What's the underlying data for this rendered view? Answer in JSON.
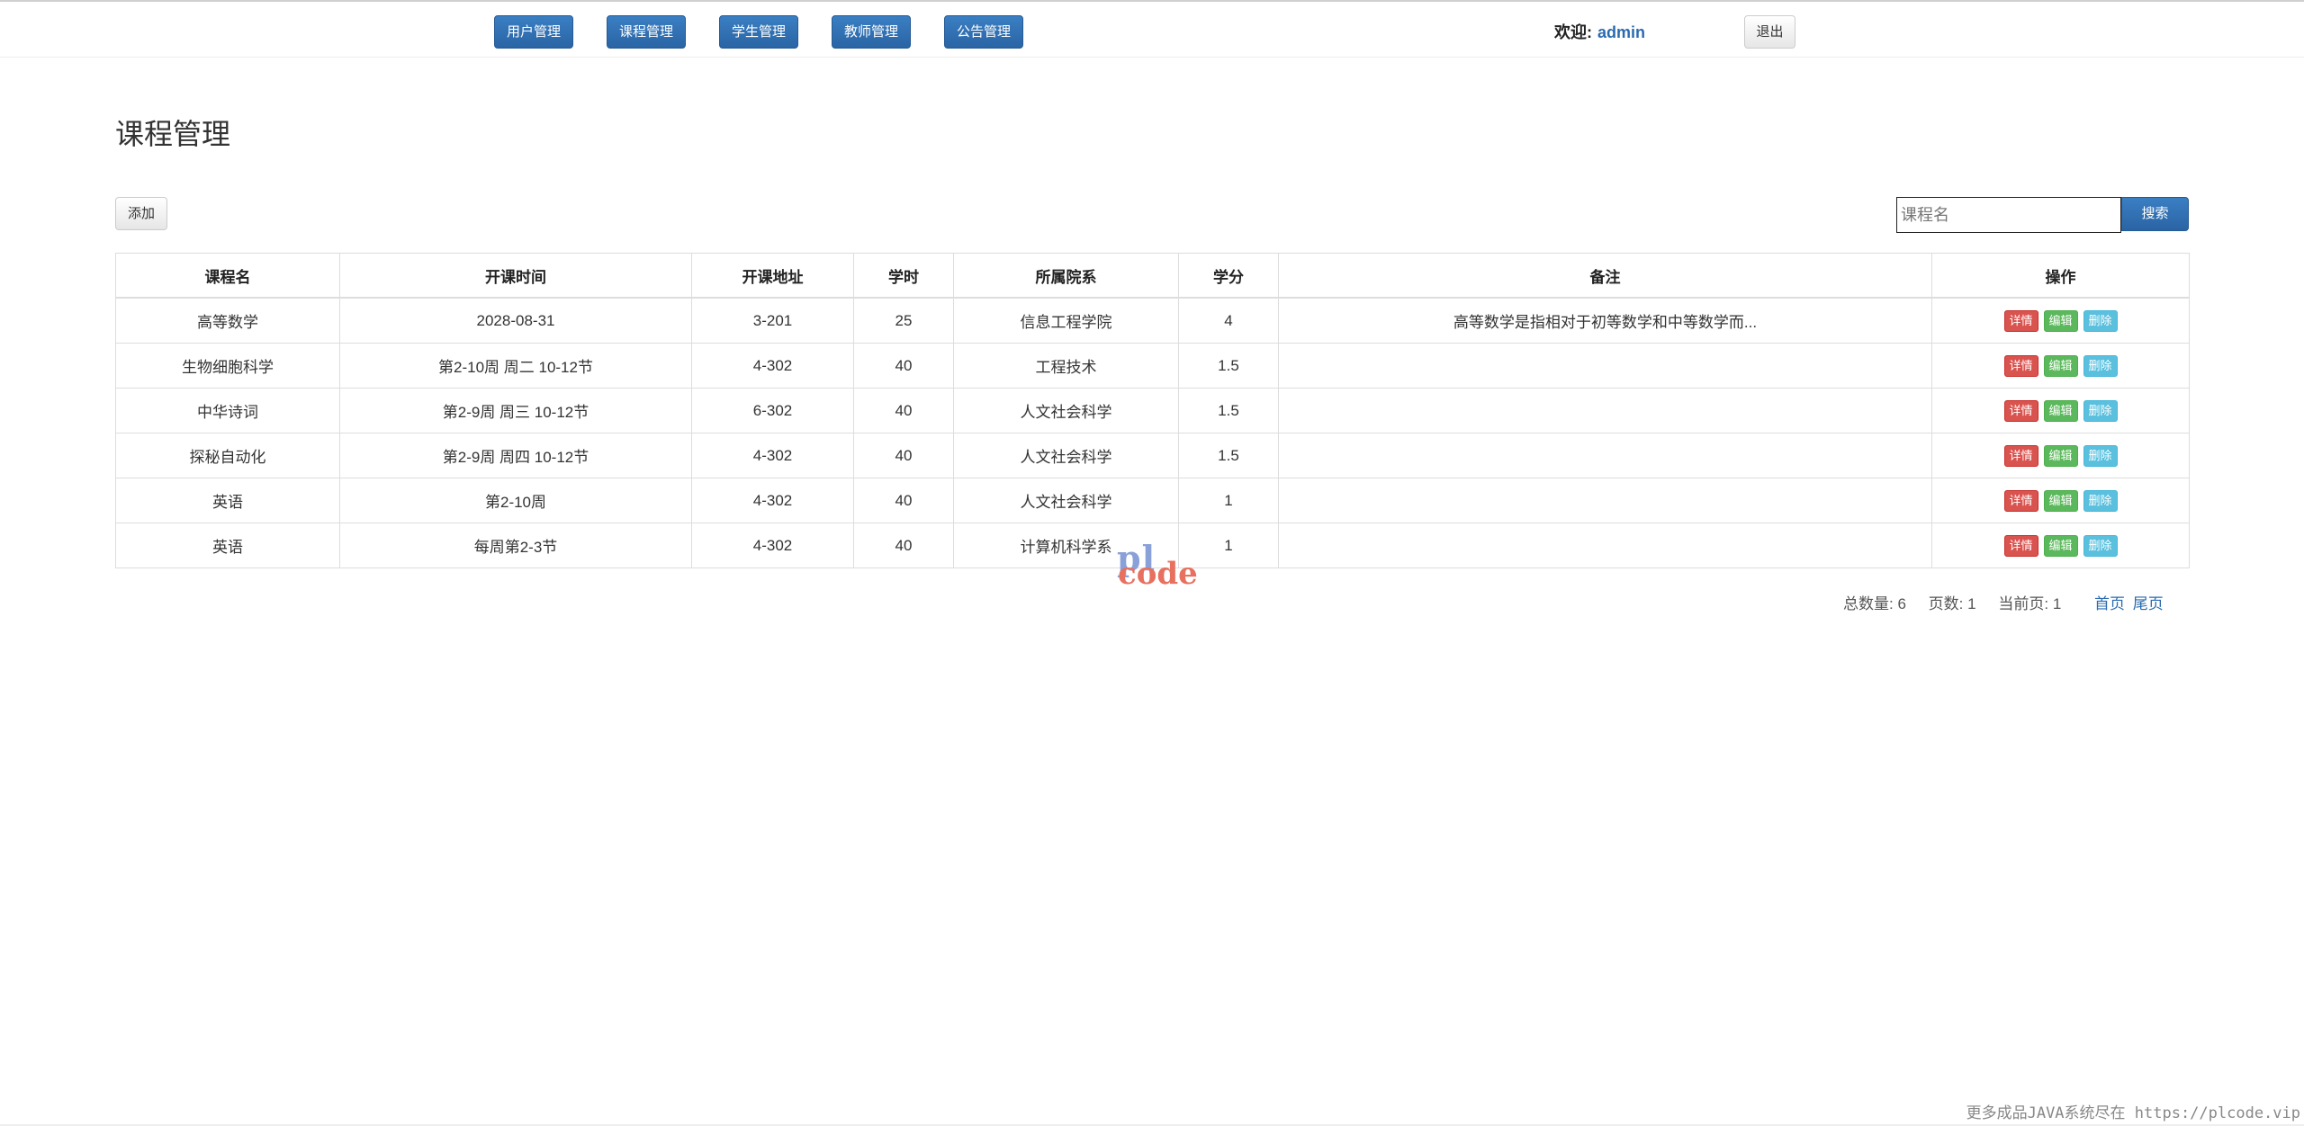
{
  "nav": {
    "items": [
      {
        "label": "用户管理"
      },
      {
        "label": "课程管理"
      },
      {
        "label": "学生管理"
      },
      {
        "label": "教师管理"
      },
      {
        "label": "公告管理"
      }
    ],
    "welcome_label": "欢迎:",
    "username": "admin",
    "logout_label": "退出"
  },
  "page": {
    "title": "课程管理",
    "add_label": "添加"
  },
  "search": {
    "placeholder": "课程名",
    "value": "",
    "button_label": "搜索"
  },
  "table": {
    "headers": [
      "课程名",
      "开课时间",
      "开课地址",
      "学时",
      "所属院系",
      "学分",
      "备注",
      "操作"
    ],
    "rows": [
      {
        "name": "高等数学",
        "time": "2028-08-31",
        "address": "3-201",
        "hours": "25",
        "department": "信息工程学院",
        "credit": "4",
        "remark": "高等数学是指相对于初等数学和中等数学而..."
      },
      {
        "name": "生物细胞科学",
        "time": "第2-10周 周二 10-12节",
        "address": "4-302",
        "hours": "40",
        "department": "工程技术",
        "credit": "1.5",
        "remark": ""
      },
      {
        "name": "中华诗词",
        "time": "第2-9周 周三 10-12节",
        "address": "6-302",
        "hours": "40",
        "department": "人文社会科学",
        "credit": "1.5",
        "remark": ""
      },
      {
        "name": "探秘自动化",
        "time": "第2-9周 周四 10-12节",
        "address": "4-302",
        "hours": "40",
        "department": "人文社会科学",
        "credit": "1.5",
        "remark": ""
      },
      {
        "name": "英语",
        "time": "第2-10周",
        "address": "4-302",
        "hours": "40",
        "department": "人文社会科学",
        "credit": "1",
        "remark": ""
      },
      {
        "name": "英语",
        "time": "每周第2-3节",
        "address": "4-302",
        "hours": "40",
        "department": "计算机科学系",
        "credit": "1",
        "remark": ""
      }
    ],
    "actions": {
      "detail_label": "详情",
      "edit_label": "编辑",
      "delete_label": "删除"
    }
  },
  "pagination": {
    "total_label": "总数量:",
    "total_value": "6",
    "pages_label": "页数:",
    "pages_value": "1",
    "current_label": "当前页:",
    "current_value": "1",
    "first_label": "首页",
    "last_label": "尾页"
  },
  "watermark": {
    "line1": "pl",
    "line2": "code"
  },
  "footer": {
    "text": "更多成品JAVA系统尽在 https://plcode.vip"
  },
  "colors": {
    "primary": "#2a6bb0",
    "danger": "#d9534f",
    "success": "#5cb85c",
    "info": "#5bc0de",
    "border": "#dddddd"
  }
}
